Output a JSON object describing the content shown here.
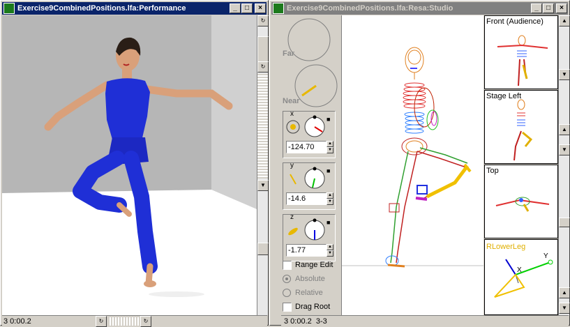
{
  "left_window": {
    "title": "Exercise9CombinedPositions.lfa:Performance",
    "status_text": "3 0:00.2"
  },
  "right_window": {
    "title": "Exercise9CombinedPositions.lfa:Resa:Studio",
    "status_text": "3 0:00.2  3-3"
  },
  "controls": {
    "far_label": "Far",
    "near_label": "Near",
    "x": {
      "label": "x",
      "value": "-124.70"
    },
    "y": {
      "label": "y",
      "value": "-14.6"
    },
    "z": {
      "label": "z",
      "value": "-1.77"
    },
    "range_edit_label": "Range Edit",
    "absolute_label": "Absolute",
    "relative_label": "Relative",
    "drag_root_label": "Drag Root"
  },
  "views": {
    "front_label": "Front (Audience)",
    "stage_left_label": "Stage Left",
    "top_label": "Top",
    "selected_label": "RLowerLeg",
    "axis_x_label": "X",
    "axis_y_label": "Y"
  },
  "title_buttons": {
    "minimize": "_",
    "maximize": "□",
    "close": "×"
  },
  "colors": {
    "title_active": "#0a246a",
    "title_inactive": "#808080",
    "dancer_suit": "#1f2fd6",
    "skin": "#d9a07a",
    "stage_floor": "#ffffff",
    "stage_wall": "#b8b8b8",
    "selected_label_color": "#e0b000"
  }
}
